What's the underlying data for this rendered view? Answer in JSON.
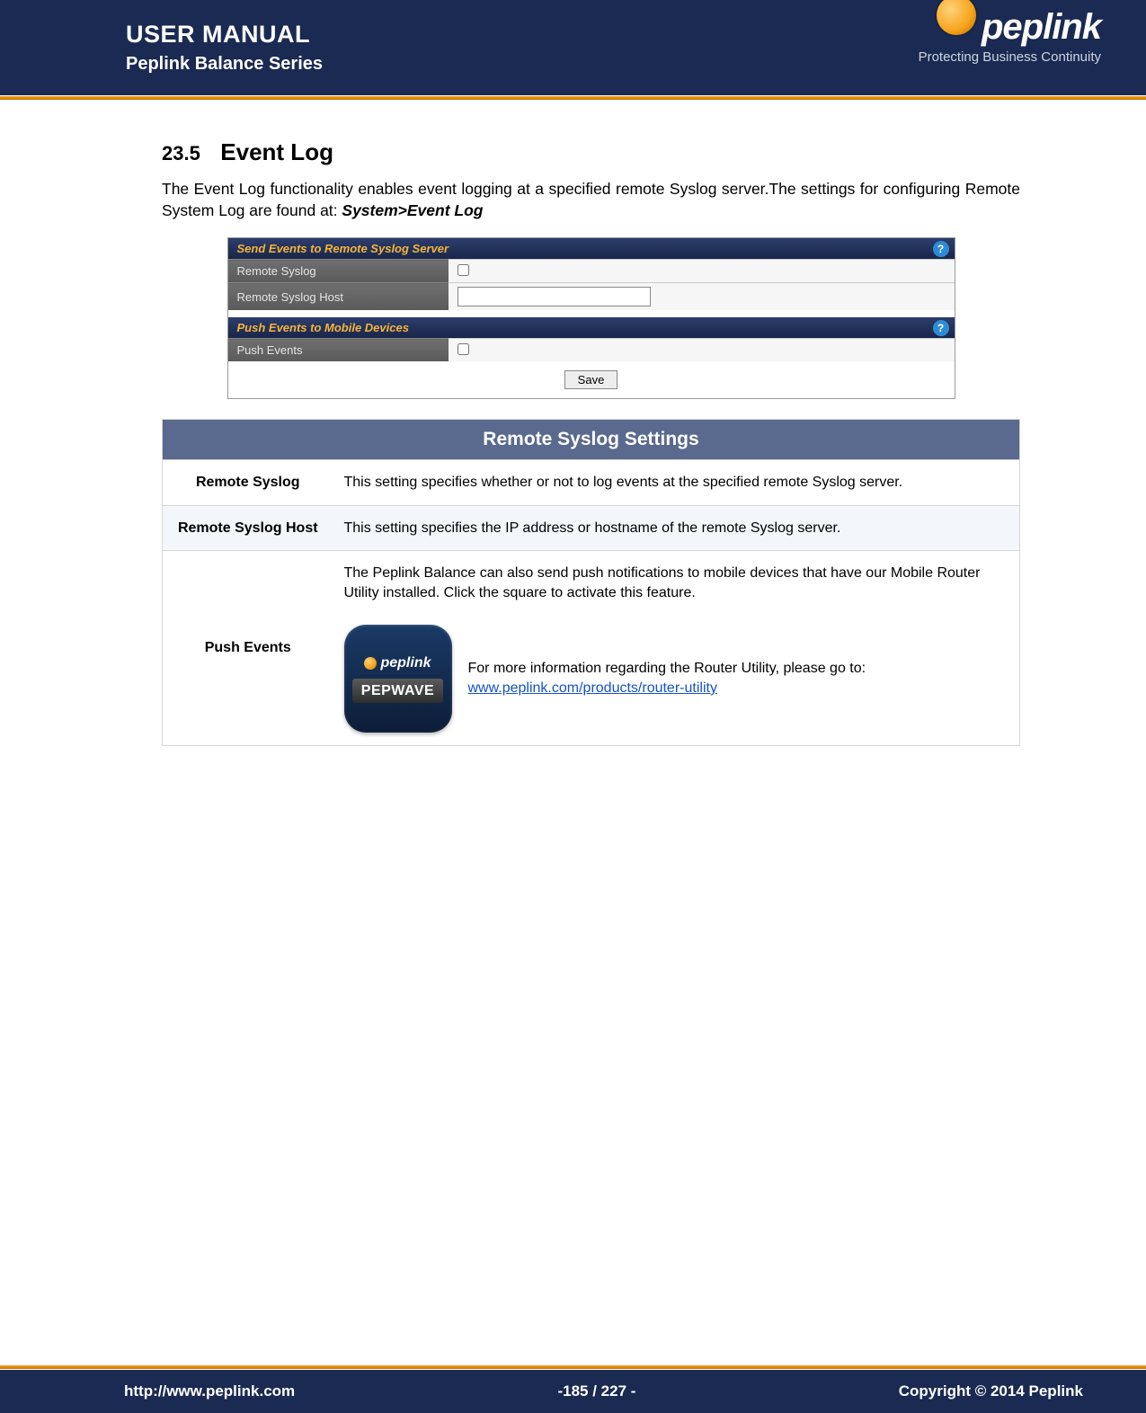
{
  "header": {
    "title1": "USER MANUAL",
    "title2": "Peplink Balance Series",
    "brand": "peplink",
    "tagline": "Protecting Business Continuity"
  },
  "section": {
    "number": "23.5",
    "title": "Event Log",
    "intro_pre": "The Event Log functionality enables event logging at a specified remote Syslog server.The settings for configuring Remote System Log are found at: ",
    "intro_path": "System>Event Log"
  },
  "cfg": {
    "panel1_title": "Send Events to Remote Syslog Server",
    "row_syslog": "Remote Syslog",
    "row_host": "Remote Syslog Host",
    "panel2_title": "Push Events to Mobile Devices",
    "row_push": "Push Events",
    "save": "Save",
    "help_glyph": "?"
  },
  "desc": {
    "table_title": "Remote Syslog Settings",
    "rows": [
      {
        "label": "Remote Syslog",
        "text": "This setting specifies whether or not to log events at the specified remote Syslog server."
      },
      {
        "label": "Remote Syslog Host",
        "text": "This setting specifies the IP address or hostname of the remote Syslog server."
      },
      {
        "label": "Push Events",
        "text1": "The Peplink Balance can also send push notifications to mobile devices that have our Mobile Router Utility installed. Click the square to activate this feature.",
        "text2": "For more information regarding the Router Utility, please go to:",
        "link": "www.peplink.com/products/router-utility"
      }
    ]
  },
  "app_icon": {
    "line1": "peplink",
    "line2": "PEPWAVE"
  },
  "footer": {
    "url": "http://www.peplink.com",
    "page": "-185 / 227 -",
    "copyright": "Copyright © 2014 Peplink"
  }
}
